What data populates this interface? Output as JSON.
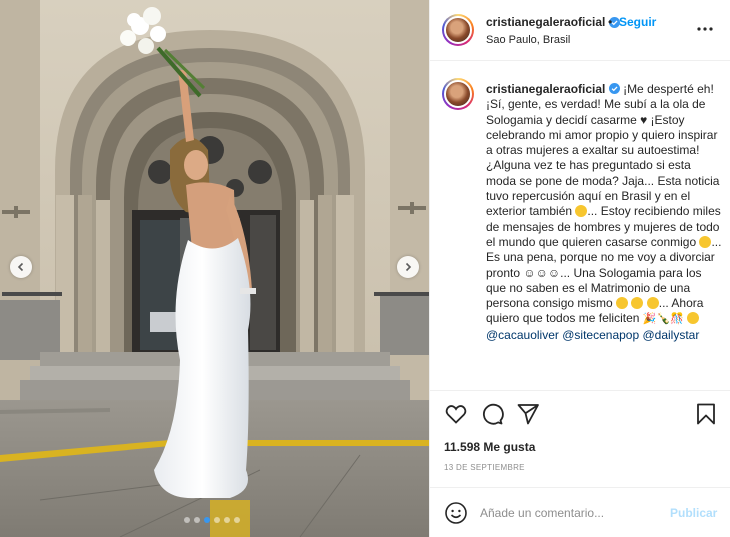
{
  "post": {
    "username": "cristianegaleraoficial",
    "follow_label": "Seguir",
    "follow_separator": "•",
    "location": "Sao Paulo, Brasil",
    "more_icon": "more-horizontal-icon"
  },
  "caption": {
    "username": "cristianegaleraoficial",
    "text_1": " ¡Me desperté eh! ¡Sí, gente, es verdad! Me subí a la ola de Sologamia y decidí casarme ♥  ¡Estoy celebrando mi amor propio y quiero inspirar a otras mujeres a exaltar su autoestima! ¿Alguna vez te has preguntado si esta moda se pone de moda? Jaja... Esta noticia tuvo repercusión aquí en Brasil y en el exterior también ",
    "text_2": "... Estoy recibiendo miles de mensajes de hombres y mujeres de todo el mundo que quieren casarse conmigo ",
    "text_3": "... Es una pena, porque no me voy a divorciar pronto ☺☺☺... Una Sologamia para los que no saben es el Matrimonio de una persona consigo mismo ",
    "text_4": "... Ahora quiero que todos me feliciten ",
    "mention_1": "@cacauoliver",
    "mention_2": "@sitecenapop",
    "mention_3": "@dailystar"
  },
  "actions": {
    "like_icon": "heart-icon",
    "comment_icon": "comment-icon",
    "share_icon": "send-icon",
    "save_icon": "bookmark-icon"
  },
  "likes": "11.598 Me gusta",
  "date": "13 DE SEPTIEMBRE",
  "comment": {
    "placeholder": "Añade un comentario...",
    "publish_label": "Publicar",
    "emoji_icon": "smiley-icon"
  },
  "carousel": {
    "prev_icon": "chevron-left-icon",
    "next_icon": "chevron-right-icon",
    "total_slides": 6,
    "active_slide": 3
  },
  "colors": {
    "accent": "#0095f6",
    "publish_disabled": "#b2dffc",
    "active_dot": "#3897f0",
    "text": "#262626",
    "muted": "#8e8e8e",
    "mention": "#00376b"
  }
}
